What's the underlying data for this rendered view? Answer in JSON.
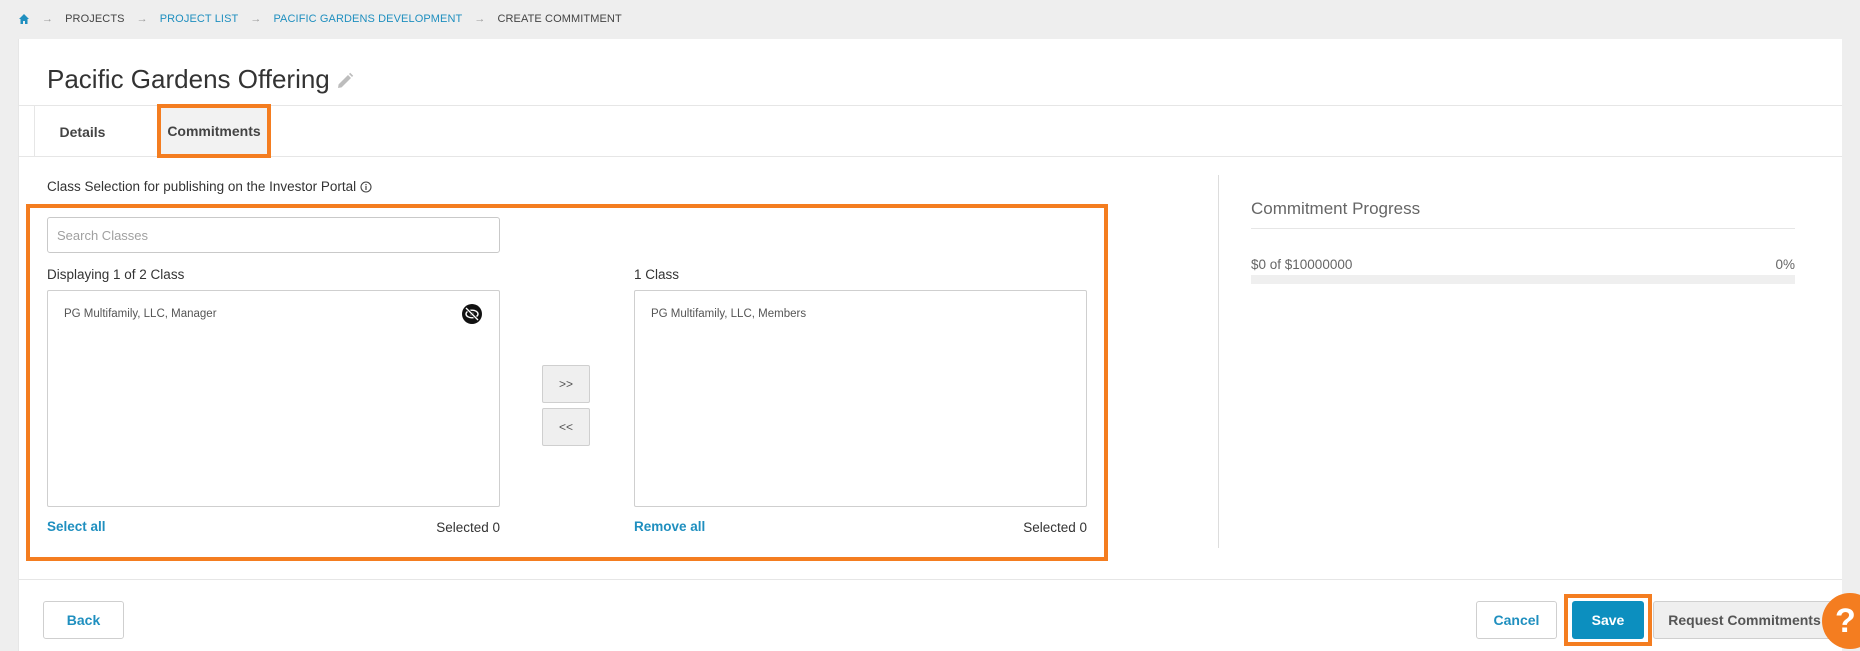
{
  "breadcrumb": {
    "items": [
      {
        "label": "PROJECTS",
        "link": false
      },
      {
        "label": "PROJECT LIST",
        "link": true
      },
      {
        "label": "PACIFIC GARDENS DEVELOPMENT",
        "link": true
      },
      {
        "label": "CREATE COMMITMENT",
        "link": false
      }
    ]
  },
  "page": {
    "title": "Pacific Gardens Offering"
  },
  "tabs": [
    {
      "label": "Details",
      "active": false
    },
    {
      "label": "Commitments",
      "active": true
    }
  ],
  "class_selection": {
    "label": "Class Selection for publishing on the Investor Portal",
    "search_placeholder": "Search Classes",
    "available": {
      "caption": "Displaying 1 of 2 Class",
      "items": [
        "PG Multifamily, LLC, Manager"
      ],
      "select_all_label": "Select all",
      "selected_text": "Selected 0"
    },
    "chosen": {
      "caption": "1 Class",
      "items": [
        "PG Multifamily, LLC, Members"
      ],
      "remove_all_label": "Remove all",
      "selected_text": "Selected 0"
    },
    "move_right_label": ">>",
    "move_left_label": "<<"
  },
  "progress": {
    "title": "Commitment Progress",
    "amount_text": "$0  of  $10000000",
    "percent_text": "0%",
    "percent_value": 0
  },
  "footer": {
    "back_label": "Back",
    "cancel_label": "Cancel",
    "save_label": "Save",
    "request_label": "Request Commitments"
  },
  "help": {
    "glyph": "?"
  },
  "colors": {
    "accent": "#1f8fbf",
    "highlight": "#f47d20",
    "save_bg": "#0c8fbf"
  }
}
